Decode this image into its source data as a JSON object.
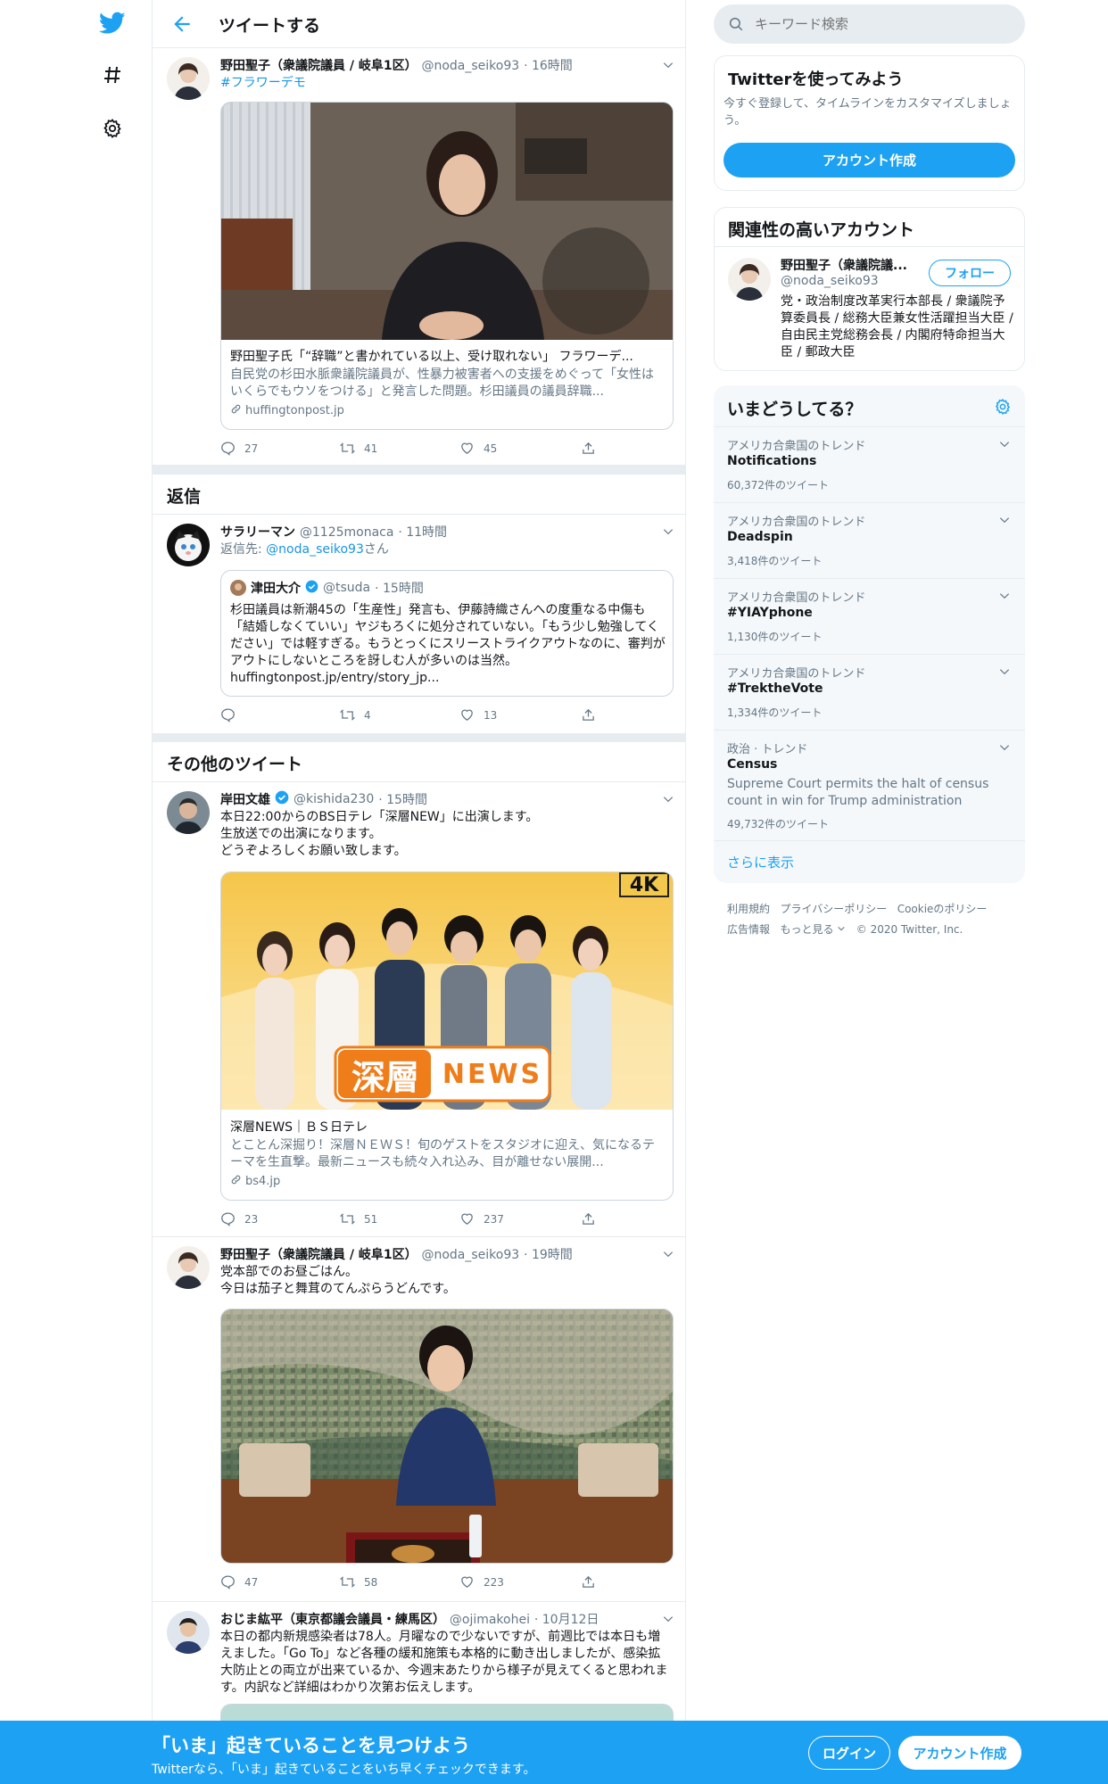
{
  "header": {
    "title": "ツイートする"
  },
  "search": {
    "placeholder": "キーワード検索"
  },
  "main_tweet": {
    "name": "野田聖子（衆議院議員 / 岐阜1区）",
    "handle": "@noda_seiko93",
    "time": "· 16時間",
    "hashtag": "#フラワーデモ",
    "card": {
      "title": "野田聖子氏「“辞職”と書かれている以上、受け取れない」 フラワーデ...",
      "desc": "自民党の杉田水脈衆議院議員が、性暴力被害者への支援をめぐって「女性はいくらでもウソをつける」と発言した問題。杉田議員の議員辞職...",
      "domain": "huffingtonpost.jp"
    },
    "replies": "27",
    "retweets": "41",
    "likes": "45"
  },
  "replies_section": {
    "title": "返信"
  },
  "reply_tweet": {
    "name": "サラリーマン",
    "handle": "@1125monaca",
    "time": "· 11時間",
    "reply_to_prefix": "返信先: ",
    "reply_to": "@noda_seiko93",
    "reply_to_suffix": "さん",
    "quote": {
      "name": "津田大介",
      "handle": "@tsuda",
      "time": "· 15時間",
      "text": "杉田議員は新潮45の「生産性」発言も、伊藤詩織さんへの度重なる中傷も「結婚しなくていい」ヤジもろくに処分されていない。「もう少し勉強してください」では軽すぎる。もうとっくにスリーストライクアウトなのに、審判がアウトにしないところを訝しむ人が多いのは当然。",
      "link": "huffingtonpost.jp/entry/story_jp..."
    },
    "replies": "",
    "retweets": "4",
    "likes": "13"
  },
  "other_section": {
    "title": "その他のツイート"
  },
  "tweet_kishida": {
    "name": "岸田文雄",
    "handle": "@kishida230",
    "time": "· 15時間",
    "text1": "本日22:00からのBS日テレ「深層NEW」に出演します。",
    "text2": "生放送での出演になります。",
    "text3": "どうぞよろしくお願い致します。",
    "card": {
      "image_logo": "深層",
      "image_logo2": "NEWS",
      "badge": "4K",
      "title": "深層NEWS｜ＢＳ日テレ",
      "desc": "とことん深掘り！深層ＮＥＷＳ！旬のゲストをスタジオに迎え、気になるテーマを生直撃。最新ニュースも続々入れ込み、目が離せない展開...",
      "domain": "bs4.jp"
    },
    "replies": "23",
    "retweets": "51",
    "likes": "237"
  },
  "tweet_noda2": {
    "name": "野田聖子（衆議院議員 / 岐阜1区）",
    "handle": "@noda_seiko93",
    "time": "· 19時間",
    "text1": "党本部でのお昼ごはん。",
    "text2": "今日は茄子と舞茸のてんぷらうどんです。",
    "replies": "47",
    "retweets": "58",
    "likes": "223"
  },
  "tweet_ojima": {
    "name": "おじま紘平（東京都議会議員・練馬区）",
    "handle": "@ojimakohei",
    "time": "· 10月12日",
    "text": "本日の都内新規感染者は78人。月曜なので少ないですが、前週比では本日も増えました。「Go To」など各種の緩和施策も本格的に動き出しましたが、感染拡大防止との両立が出来ているか、今週末あたりから様子が見えてくると思われます。内訳など詳細はわかり次第お伝えします。"
  },
  "signup": {
    "title": "Twitterを使ってみよう",
    "desc": "今すぐ登録して、タイムラインをカスタマイズしましょう。",
    "button": "アカウント作成"
  },
  "related": {
    "title": "関連性の高いアカウント",
    "name": "野田聖子（衆議院議...",
    "handle": "@noda_seiko93",
    "follow": "フォロー",
    "bio": "党・政治制度改革実行本部長 / 衆議院予算委員長 / 総務大臣兼女性活躍担当大臣 / 自由民主党総務会長 / 内閣府特命担当大臣 / 郵政大臣"
  },
  "trends": {
    "title": "いまどうしてる？",
    "items": [
      {
        "cat": "アメリカ合衆国のトレンド",
        "name": "Notifications",
        "count": "60,372件のツイート",
        "desc": ""
      },
      {
        "cat": "アメリカ合衆国のトレンド",
        "name": "Deadspin",
        "count": "3,418件のツイート",
        "desc": ""
      },
      {
        "cat": "アメリカ合衆国のトレンド",
        "name": "#YIAYphone",
        "count": "1,130件のツイート",
        "desc": ""
      },
      {
        "cat": "アメリカ合衆国のトレンド",
        "name": "#TrektheVote",
        "count": "1,334件のツイート",
        "desc": ""
      },
      {
        "cat": "政治 · トレンド",
        "name": "Census",
        "count": "49,732件のツイート",
        "desc": "Supreme Court permits the halt of census count in win for Trump administration"
      }
    ],
    "more": "さらに表示"
  },
  "footer": {
    "terms": "利用規約",
    "privacy": "プライバシーポリシー",
    "cookie": "Cookieのポリシー",
    "ads": "広告情報",
    "more": "もっと見る",
    "copyright": "© 2020 Twitter, Inc."
  },
  "bottom_bar": {
    "title": "「いま」起きていることを見つけよう",
    "sub": "Twitterなら、「いま」起きていることをいち早くチェックできます。",
    "login": "ログイン",
    "signup": "アカウント作成"
  },
  "colors": {
    "accent": "#1da1f2",
    "secondary_text": "#657786",
    "border": "#e6ecf0"
  }
}
